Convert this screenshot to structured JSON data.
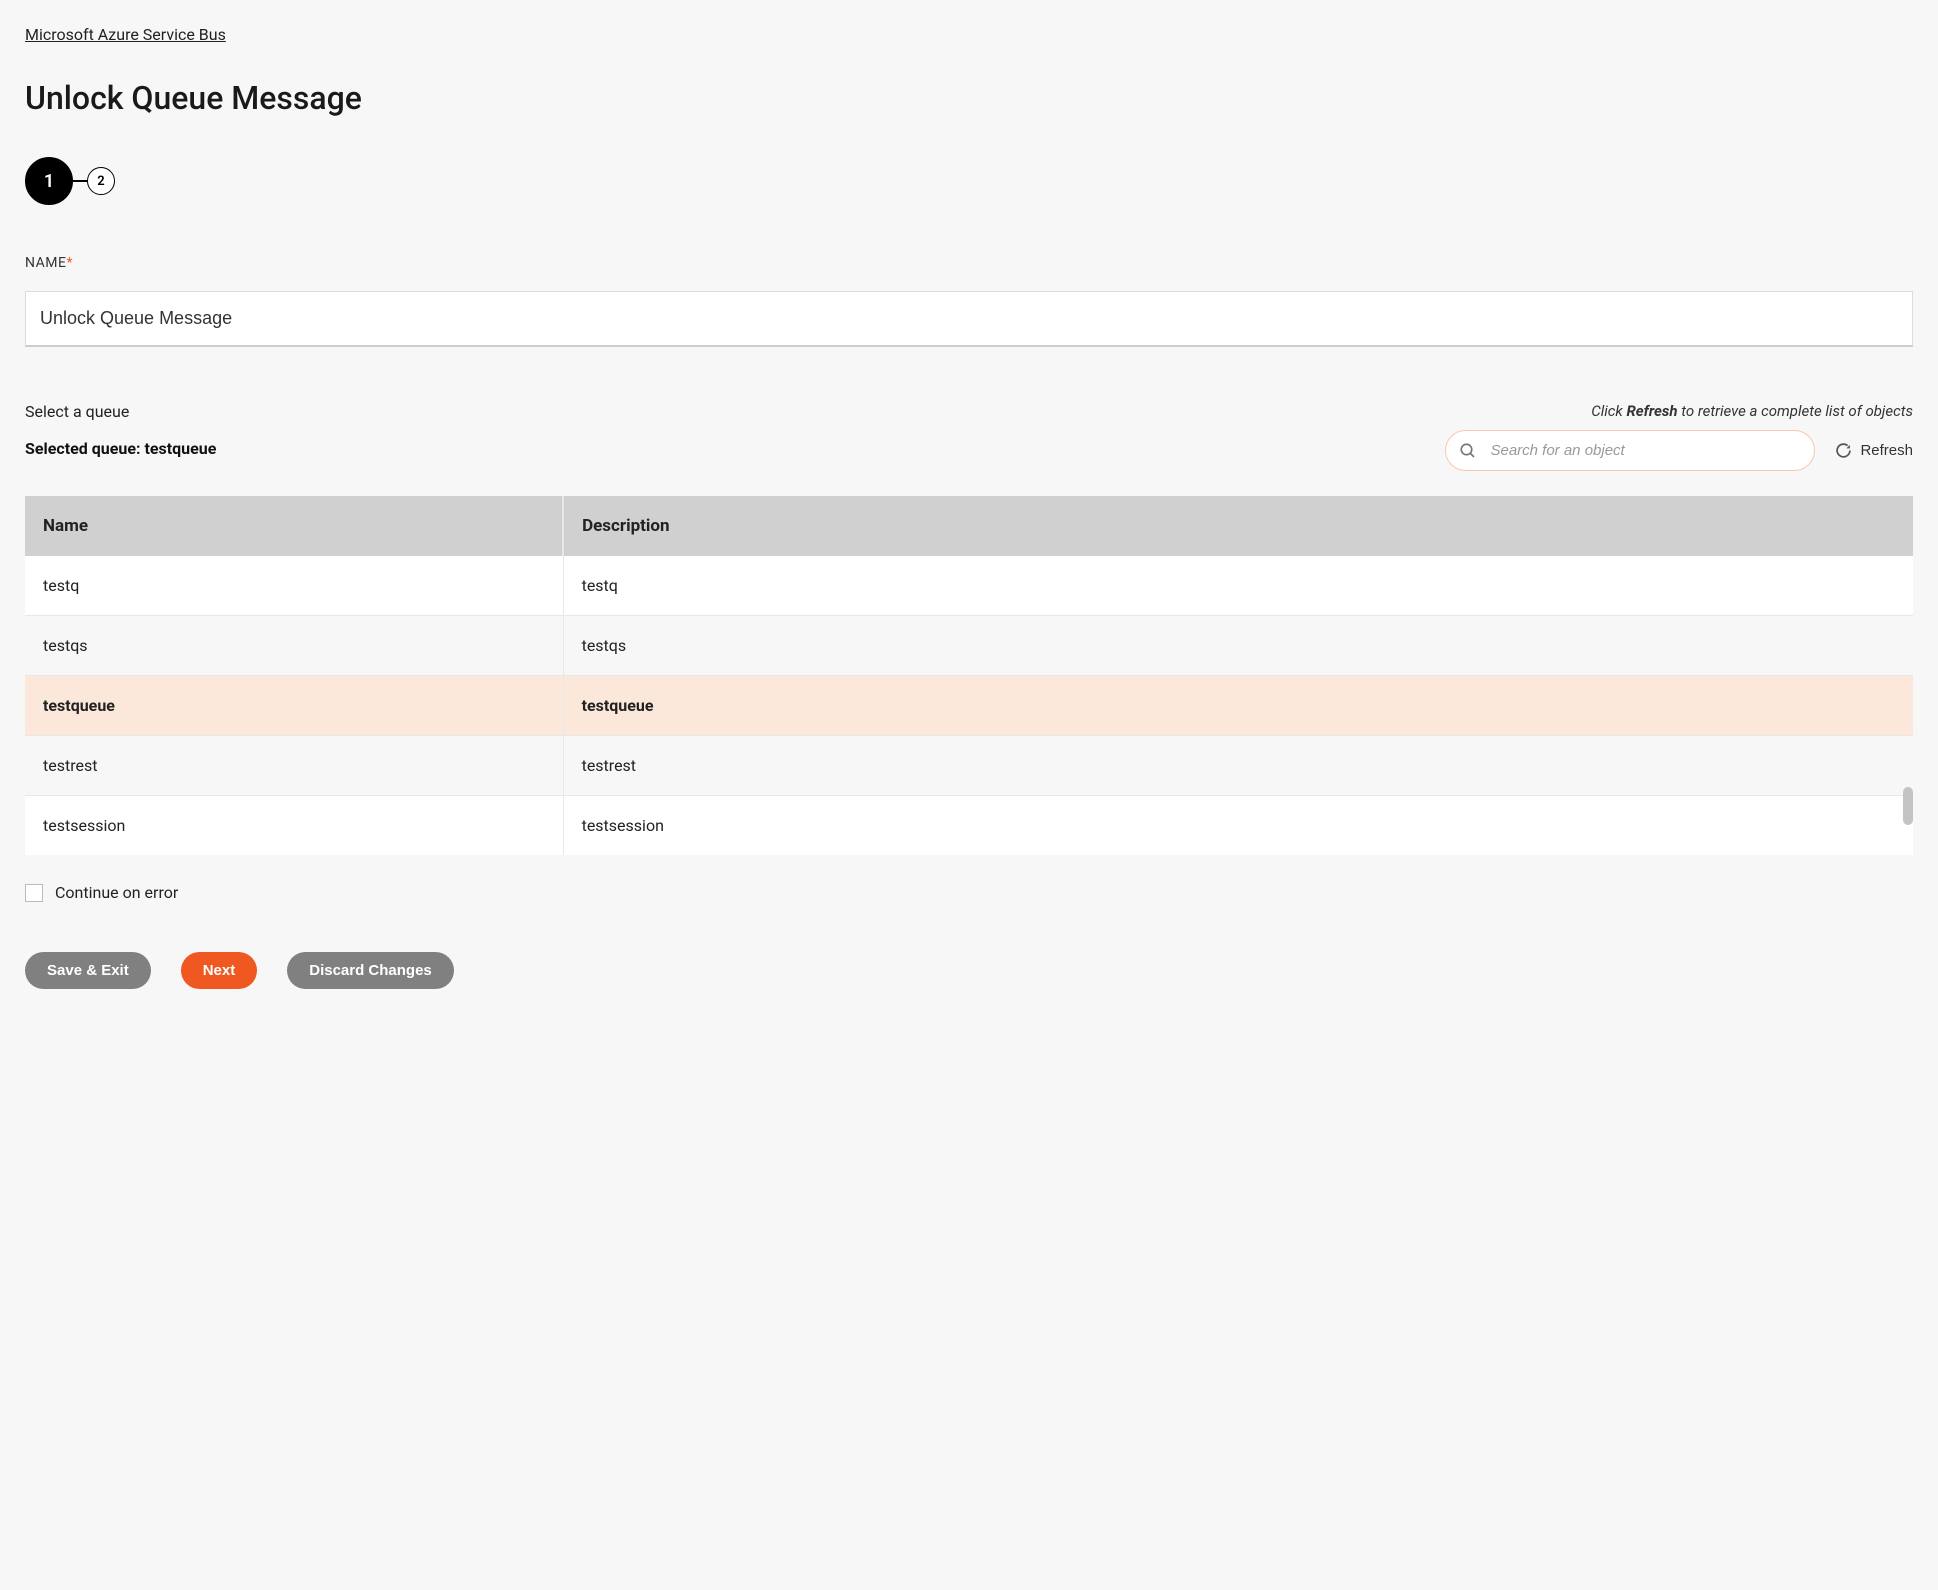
{
  "breadcrumb": {
    "label": "Microsoft Azure Service Bus"
  },
  "page": {
    "title": "Unlock Queue Message"
  },
  "stepper": {
    "steps": [
      "1",
      "2"
    ],
    "active": 0
  },
  "form": {
    "name_label": "NAME",
    "name_value": "Unlock Queue Message"
  },
  "queue": {
    "select_label": "Select a queue",
    "selected_prefix": "Selected queue: ",
    "selected_value": "testqueue",
    "hint_prefix": "Click ",
    "hint_bold": "Refresh",
    "hint_suffix": " to retrieve a complete list of objects",
    "search_placeholder": "Search for an object",
    "refresh_label": "Refresh"
  },
  "table": {
    "columns": [
      "Name",
      "Description"
    ],
    "rows": [
      {
        "name": "testq",
        "desc": "testq",
        "selected": false
      },
      {
        "name": "testqs",
        "desc": "testqs",
        "selected": false
      },
      {
        "name": "testqueue",
        "desc": "testqueue",
        "selected": true
      },
      {
        "name": "testrest",
        "desc": "testrest",
        "selected": false
      },
      {
        "name": "testsession",
        "desc": "testsession",
        "selected": false
      }
    ]
  },
  "options": {
    "continue_on_error": "Continue on error"
  },
  "buttons": {
    "save_exit": "Save & Exit",
    "next": "Next",
    "discard": "Discard Changes"
  }
}
